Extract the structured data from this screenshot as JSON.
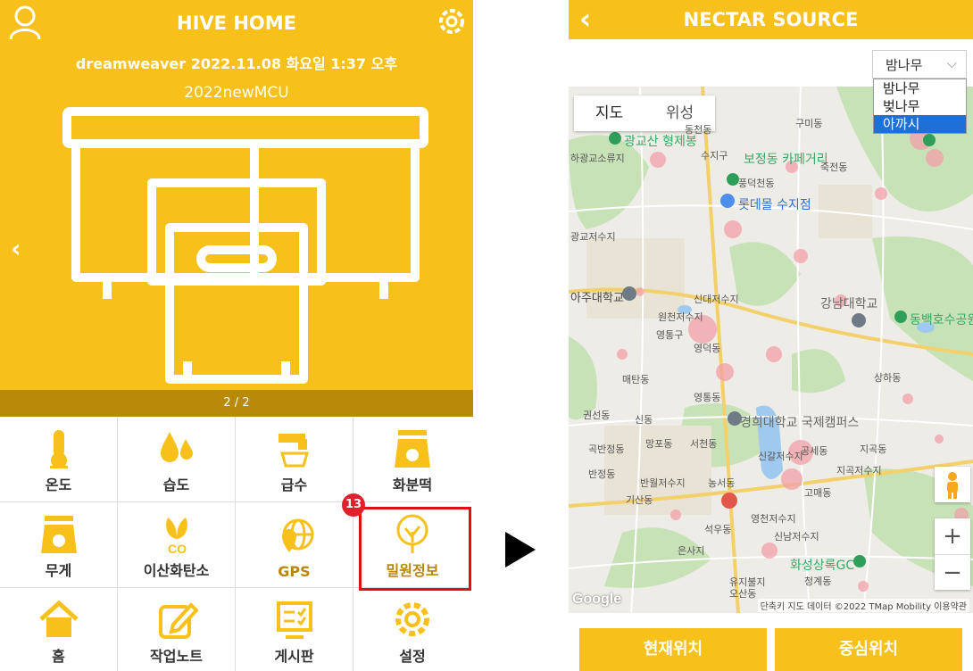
{
  "left": {
    "header": {
      "title": "HIVE HOME",
      "subtitle": "dreamweaver 2022.11.08 화요일 1:37 오후",
      "device": "2022newMCU"
    },
    "pager": "2 / 2",
    "menu": [
      {
        "label": "온도",
        "icon": "thermometer-icon"
      },
      {
        "label": "습도",
        "icon": "humidity-icon"
      },
      {
        "label": "급수",
        "icon": "water-tap-icon"
      },
      {
        "label": "화분떡",
        "icon": "scale-icon"
      },
      {
        "label": "무게",
        "icon": "weight-icon"
      },
      {
        "label": "이산화탄소",
        "icon": "co2-icon"
      },
      {
        "label": "GPS",
        "icon": "gps-icon"
      },
      {
        "label": "밀원정보",
        "icon": "tree-icon"
      },
      {
        "label": "홈",
        "icon": "home-icon"
      },
      {
        "label": "작업노트",
        "icon": "note-edit-icon"
      },
      {
        "label": "게시판",
        "icon": "board-icon"
      },
      {
        "label": "설정",
        "icon": "settings-icon"
      }
    ],
    "badge": "13"
  },
  "right": {
    "header": {
      "title": "NECTAR SOURCE"
    },
    "select": {
      "value": "밤나무",
      "options": [
        "밤나무",
        "벚나무",
        "아까시"
      ],
      "highlighted": "아까시"
    },
    "map": {
      "type_buttons": [
        "지도",
        "위성"
      ],
      "labels": [
        "광교산 형제봉",
        "보정동 카페거리",
        "롯데몰 수지점",
        "강남대학교",
        "동백호수공원",
        "경희대학교 국제캠퍼스",
        "화성상록GC",
        "신갈저수지",
        "지곡저수지",
        "하광교소류지",
        "광교저수지",
        "아주대학교",
        "원천저수지",
        "신대저수지",
        "구미동",
        "동천동",
        "풍덕천동",
        "수지구",
        "죽전동",
        "상하동",
        "영통구",
        "매탄동",
        "영통동",
        "신동",
        "곡반정동",
        "반정동",
        "망포동",
        "서천동",
        "농서동",
        "고매동",
        "지곡동",
        "석우동",
        "영덕동",
        "공세동",
        "권선동",
        "반월저수지",
        "기산동",
        "영천저수지",
        "신남저수지",
        "청계동",
        "오산동",
        "은사지",
        "유지불지"
      ],
      "footer": "단축키  지도 데이터 ©2022 TMap Mobility  이용약관",
      "google": "Google",
      "zoom_in": "+",
      "zoom_out": "−"
    },
    "buttons": {
      "current": "현재위치",
      "center": "중심위치"
    }
  },
  "colors": {
    "accent": "#F7C01A",
    "dark_accent": "#B88A08",
    "highlight": "#E01010",
    "select_blue": "#1E70D8"
  }
}
